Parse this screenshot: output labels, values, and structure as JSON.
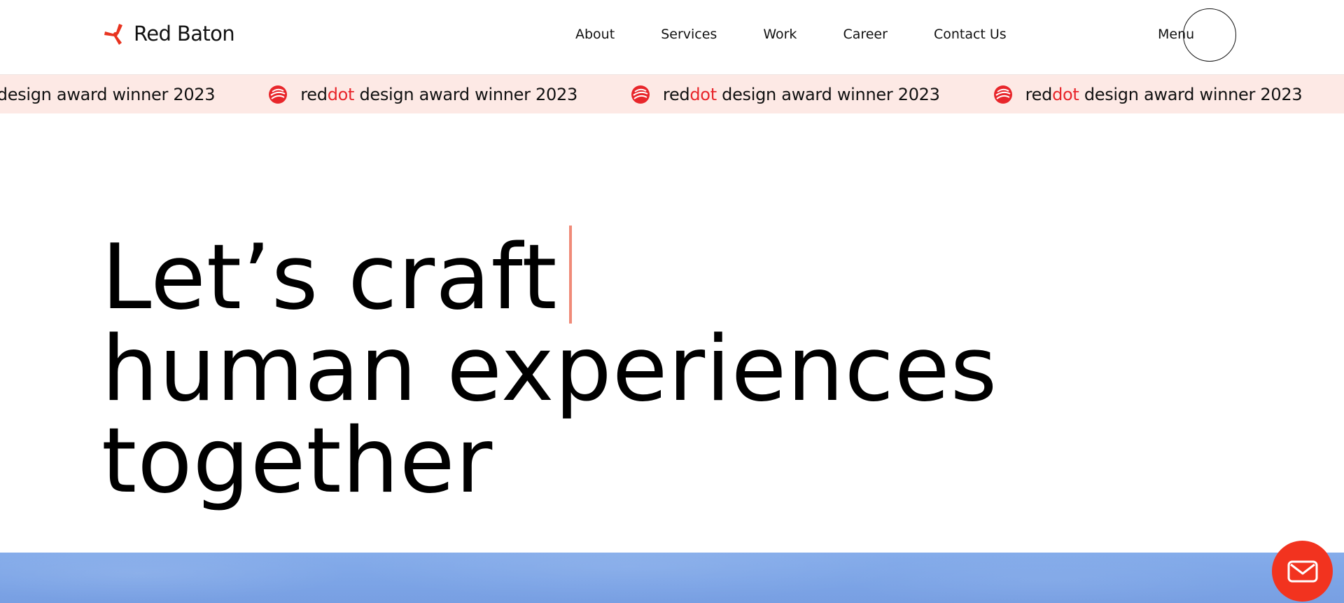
{
  "header": {
    "brand_name": "Red Baton",
    "nav_items": [
      {
        "label": "About"
      },
      {
        "label": "Services"
      },
      {
        "label": "Work"
      },
      {
        "label": "Career"
      },
      {
        "label": "Contact Us"
      }
    ],
    "menu_label": "Menu"
  },
  "marquee": {
    "brand_red": "red",
    "brand_dot": "dot",
    "award_text": " design award winner 2023",
    "partial_dot": "dot",
    "repeat_count": 5
  },
  "hero": {
    "lines": [
      "Let’s craft",
      "human experiences",
      "together"
    ]
  },
  "colors": {
    "accent_red": "#f2331f",
    "award_red": "#e8262b",
    "marquee_bg": "#fde9e5",
    "caret": "#f08a78",
    "sky_blue": "#7ca4e6"
  },
  "icons": {
    "logo": "red-baton-logo-icon",
    "award": "reddot-award-icon",
    "fab": "mail-icon"
  }
}
